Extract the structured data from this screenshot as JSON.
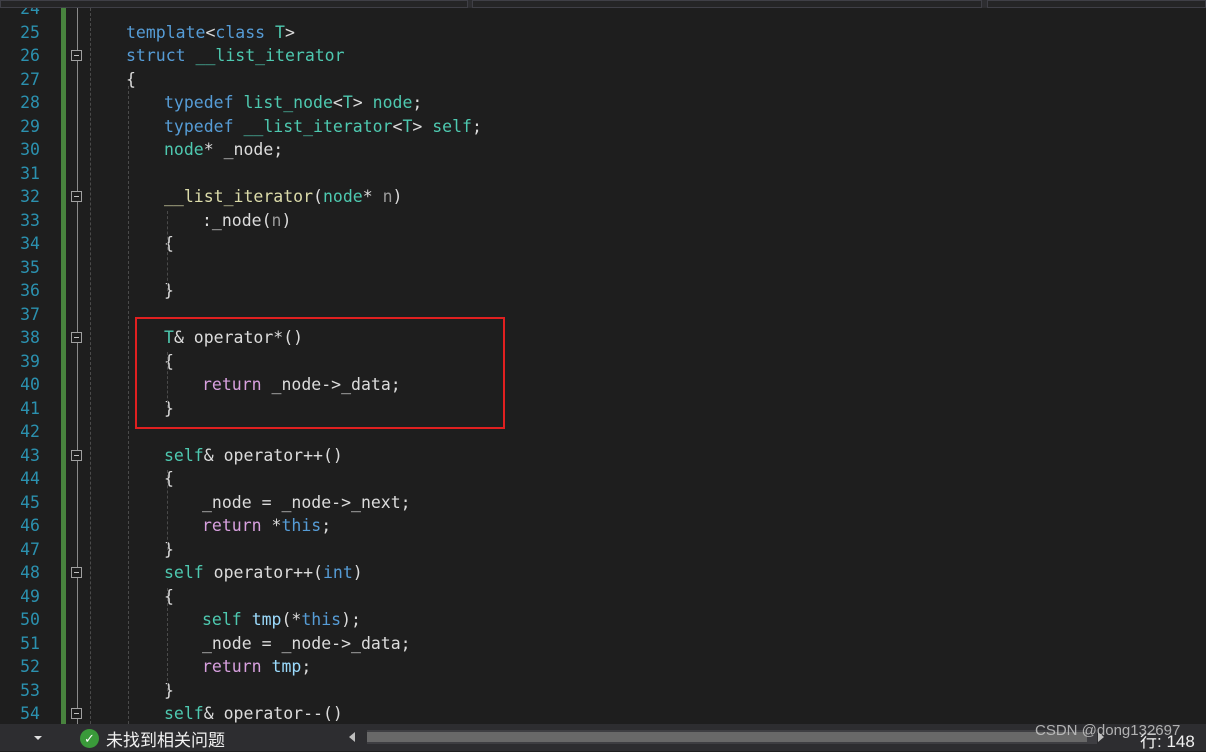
{
  "editor": {
    "lines": [
      {
        "n": "24",
        "tokens": []
      },
      {
        "n": "25",
        "indent": 0,
        "tokens": [
          {
            "c": "t-kw",
            "t": "template"
          },
          {
            "c": "t-pl",
            "t": "<"
          },
          {
            "c": "t-kw",
            "t": "class"
          },
          {
            "c": "t-pl",
            "t": " "
          },
          {
            "c": "t-ty",
            "t": "T"
          },
          {
            "c": "t-pl",
            "t": ">"
          }
        ]
      },
      {
        "n": "26",
        "indent": 0,
        "tokens": [
          {
            "c": "t-kw",
            "t": "struct"
          },
          {
            "c": "t-pl",
            "t": " "
          },
          {
            "c": "t-ty",
            "t": "__list_iterator"
          }
        ]
      },
      {
        "n": "27",
        "indent": 0,
        "tokens": [
          {
            "c": "t-pl",
            "t": "{"
          }
        ]
      },
      {
        "n": "28",
        "indent": 1,
        "tokens": [
          {
            "c": "t-kw",
            "t": "typedef"
          },
          {
            "c": "t-pl",
            "t": " "
          },
          {
            "c": "t-ty",
            "t": "list_node"
          },
          {
            "c": "t-pl",
            "t": "<"
          },
          {
            "c": "t-ty",
            "t": "T"
          },
          {
            "c": "t-pl",
            "t": "> "
          },
          {
            "c": "t-ty",
            "t": "node"
          },
          {
            "c": "t-pl",
            "t": ";"
          }
        ]
      },
      {
        "n": "29",
        "indent": 1,
        "tokens": [
          {
            "c": "t-kw",
            "t": "typedef"
          },
          {
            "c": "t-pl",
            "t": " "
          },
          {
            "c": "t-ty",
            "t": "__list_iterator"
          },
          {
            "c": "t-pl",
            "t": "<"
          },
          {
            "c": "t-ty",
            "t": "T"
          },
          {
            "c": "t-pl",
            "t": "> "
          },
          {
            "c": "t-ty",
            "t": "self"
          },
          {
            "c": "t-pl",
            "t": ";"
          }
        ]
      },
      {
        "n": "30",
        "indent": 1,
        "tokens": [
          {
            "c": "t-ty",
            "t": "node"
          },
          {
            "c": "t-pl",
            "t": "* _node;"
          }
        ]
      },
      {
        "n": "31",
        "tokens": []
      },
      {
        "n": "32",
        "indent": 1,
        "tokens": [
          {
            "c": "t-fn",
            "t": "__list_iterator"
          },
          {
            "c": "t-pl",
            "t": "("
          },
          {
            "c": "t-ty",
            "t": "node"
          },
          {
            "c": "t-pl",
            "t": "* "
          },
          {
            "c": "t-par",
            "t": "n"
          },
          {
            "c": "t-pl",
            "t": ")"
          }
        ]
      },
      {
        "n": "33",
        "indent": 2,
        "tokens": [
          {
            "c": "t-pl",
            "t": ":_node("
          },
          {
            "c": "t-par",
            "t": "n"
          },
          {
            "c": "t-pl",
            "t": ")"
          }
        ]
      },
      {
        "n": "34",
        "indent": 1,
        "tokens": [
          {
            "c": "t-pl",
            "t": "{"
          }
        ]
      },
      {
        "n": "35",
        "tokens": []
      },
      {
        "n": "36",
        "indent": 1,
        "tokens": [
          {
            "c": "t-pl",
            "t": "}"
          }
        ]
      },
      {
        "n": "37",
        "tokens": []
      },
      {
        "n": "38",
        "indent": 1,
        "tokens": [
          {
            "c": "t-ty",
            "t": "T"
          },
          {
            "c": "t-pl",
            "t": "& operator*()"
          }
        ]
      },
      {
        "n": "39",
        "indent": 1,
        "tokens": [
          {
            "c": "t-pl",
            "t": "{"
          }
        ]
      },
      {
        "n": "40",
        "indent": 2,
        "tokens": [
          {
            "c": "t-ctl",
            "t": "return"
          },
          {
            "c": "t-pl",
            "t": " _node->_data;"
          }
        ]
      },
      {
        "n": "41",
        "indent": 1,
        "tokens": [
          {
            "c": "t-pl",
            "t": "}"
          }
        ]
      },
      {
        "n": "42",
        "tokens": []
      },
      {
        "n": "43",
        "indent": 1,
        "tokens": [
          {
            "c": "t-ty",
            "t": "self"
          },
          {
            "c": "t-pl",
            "t": "& operator++()"
          }
        ]
      },
      {
        "n": "44",
        "indent": 1,
        "tokens": [
          {
            "c": "t-pl",
            "t": "{"
          }
        ]
      },
      {
        "n": "45",
        "indent": 2,
        "tokens": [
          {
            "c": "t-pl",
            "t": "_node = _node->_next;"
          }
        ]
      },
      {
        "n": "46",
        "indent": 2,
        "tokens": [
          {
            "c": "t-ctl",
            "t": "return"
          },
          {
            "c": "t-pl",
            "t": " *"
          },
          {
            "c": "t-kw",
            "t": "this"
          },
          {
            "c": "t-pl",
            "t": ";"
          }
        ]
      },
      {
        "n": "47",
        "indent": 1,
        "tokens": [
          {
            "c": "t-pl",
            "t": "}"
          }
        ]
      },
      {
        "n": "48",
        "indent": 1,
        "tokens": [
          {
            "c": "t-ty",
            "t": "self"
          },
          {
            "c": "t-pl",
            "t": " operator++("
          },
          {
            "c": "t-kw",
            "t": "int"
          },
          {
            "c": "t-pl",
            "t": ")"
          }
        ]
      },
      {
        "n": "49",
        "indent": 1,
        "tokens": [
          {
            "c": "t-pl",
            "t": "{"
          }
        ]
      },
      {
        "n": "50",
        "indent": 2,
        "tokens": [
          {
            "c": "t-ty",
            "t": "self"
          },
          {
            "c": "t-pl",
            "t": " "
          },
          {
            "c": "t-var",
            "t": "tmp"
          },
          {
            "c": "t-pl",
            "t": "(*"
          },
          {
            "c": "t-kw",
            "t": "this"
          },
          {
            "c": "t-pl",
            "t": ");"
          }
        ]
      },
      {
        "n": "51",
        "indent": 2,
        "tokens": [
          {
            "c": "t-pl",
            "t": "_node = _node->_data;"
          }
        ]
      },
      {
        "n": "52",
        "indent": 2,
        "tokens": [
          {
            "c": "t-ctl",
            "t": "return"
          },
          {
            "c": "t-pl",
            "t": " "
          },
          {
            "c": "t-var",
            "t": "tmp"
          },
          {
            "c": "t-pl",
            "t": ";"
          }
        ]
      },
      {
        "n": "53",
        "indent": 1,
        "tokens": [
          {
            "c": "t-pl",
            "t": "}"
          }
        ]
      },
      {
        "n": "54",
        "indent": 1,
        "tokens": [
          {
            "c": "t-ty",
            "t": "self"
          },
          {
            "c": "t-pl",
            "t": "& operator--()"
          }
        ]
      }
    ]
  },
  "statusbar": {
    "issues_text": "未找到相关问题",
    "row_text": "行: 148"
  },
  "watermark": "CSDN @dong132697",
  "colors": {
    "highlight_box": "#e02020",
    "background": "#1e1e1e",
    "line_number": "#2b91af"
  }
}
